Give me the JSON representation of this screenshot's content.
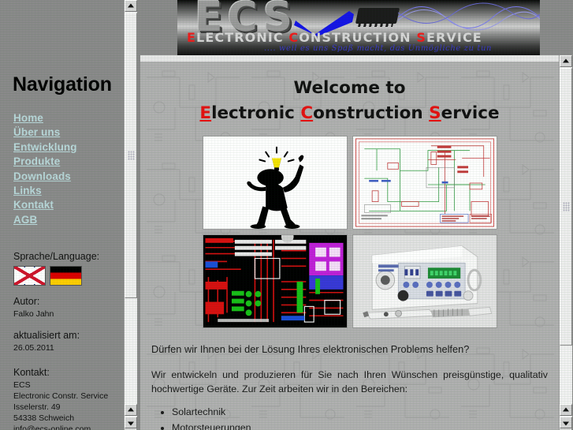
{
  "sidebar": {
    "title": "Navigation",
    "links": [
      {
        "label": "Home"
      },
      {
        "label": "Über uns"
      },
      {
        "label": "Entwicklung"
      },
      {
        "label": "Produkte"
      },
      {
        "label": "Downloads"
      },
      {
        "label": "Links"
      },
      {
        "label": "Kontakt"
      },
      {
        "label": "AGB"
      }
    ],
    "language": {
      "label": "Sprache/Language:",
      "flags": [
        "uk-flag",
        "germany-flag"
      ]
    },
    "author": {
      "label": "Autor:",
      "value": "Falko Jahn"
    },
    "updated": {
      "label": "aktualisiert am:",
      "value": "26.05.2011"
    },
    "contact": {
      "label": "Kontakt:",
      "lines": [
        "ECS",
        "Electronic Constr. Service",
        "Isselerstr. 49",
        "54338 Schweich",
        "info@ecs-online.com"
      ]
    }
  },
  "banner": {
    "logo_text": "ECS",
    "subtitle_parts": [
      {
        "text": "E",
        "accent": true
      },
      {
        "text": "LECTRONIC ",
        "accent": false
      },
      {
        "text": "C",
        "accent": true
      },
      {
        "text": "ONSTRUCTION ",
        "accent": false
      },
      {
        "text": "S",
        "accent": true
      },
      {
        "text": "ERVICE",
        "accent": false
      }
    ],
    "tagline": ".... weil es uns Spaß macht, das Unmögliche zu tun",
    "accent_color": "#ef1c1c",
    "tagline_color": "#3a3ac8",
    "check_color": "#1414e6"
  },
  "main": {
    "welcome_line1": "Welcome to",
    "welcome_line2": [
      {
        "text": "E",
        "accent": true
      },
      {
        "text": "lectronic ",
        "accent": false
      },
      {
        "text": "C",
        "accent": true
      },
      {
        "text": "onstruction ",
        "accent": false
      },
      {
        "text": "S",
        "accent": true
      },
      {
        "text": "ervice",
        "accent": false
      }
    ],
    "accent_color": "#e51111",
    "images": [
      {
        "name": "idea-man-illustration",
        "caption": "Schwarze Silhouette mit Glühbirne"
      },
      {
        "name": "circuit-schematic-image",
        "caption": "Schaltplan"
      },
      {
        "name": "pcb-layout-image",
        "caption": "Leiterplatten-Layout"
      },
      {
        "name": "device-photo-image",
        "caption": "Gerätefoto"
      }
    ],
    "question": "Dürfen wir Ihnen bei der Lösung Ihres elektronischen Problems helfen?",
    "paragraph": "Wir entwickeln und produzieren für Sie nach Ihren Wünschen preisgünstige, qualitativ hochwertige Geräte. Zur Zeit arbeiten wir in den Bereichen:",
    "bullets": [
      "Solartechnik",
      "Motorsteuerungen"
    ]
  },
  "scrollbars": {
    "left": {
      "up_arrow": "▲",
      "down_arrow": "▼"
    },
    "right": {
      "up_arrow": "▲",
      "down_arrow": "▼"
    }
  }
}
